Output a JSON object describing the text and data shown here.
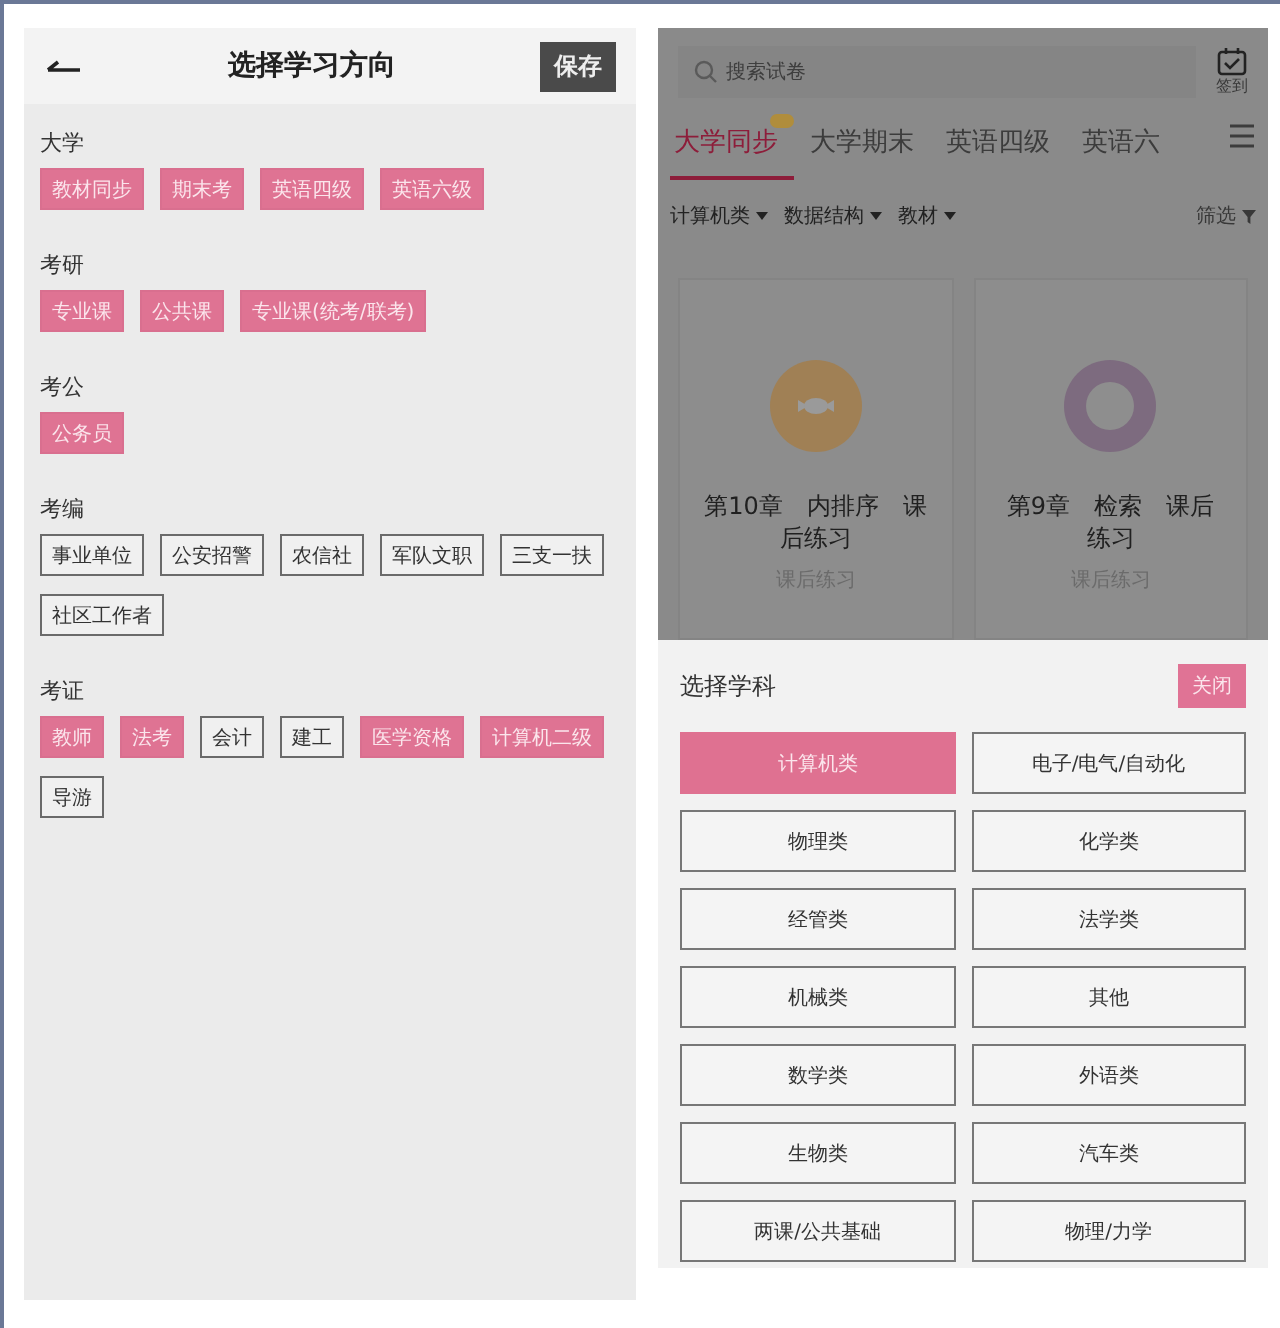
{
  "direction_screen": {
    "title": "选择学习方向",
    "save_button": "保存",
    "sections": [
      {
        "title": "大学",
        "tags": [
          {
            "label": "教材同步",
            "selected": true
          },
          {
            "label": "期末考",
            "selected": true
          },
          {
            "label": "英语四级",
            "selected": true
          },
          {
            "label": "英语六级",
            "selected": true
          }
        ]
      },
      {
        "title": "考研",
        "tags": [
          {
            "label": "专业课",
            "selected": true
          },
          {
            "label": "公共课",
            "selected": true
          },
          {
            "label": "专业课(统考/联考)",
            "selected": true
          }
        ]
      },
      {
        "title": "考公",
        "tags": [
          {
            "label": "公务员",
            "selected": true
          }
        ]
      },
      {
        "title": "考编",
        "tags": [
          {
            "label": "事业单位",
            "selected": false
          },
          {
            "label": "公安招警",
            "selected": false
          },
          {
            "label": "农信社",
            "selected": false
          },
          {
            "label": "军队文职",
            "selected": false
          },
          {
            "label": "三支一扶",
            "selected": false
          },
          {
            "label": "社区工作者",
            "selected": false
          }
        ]
      },
      {
        "title": "考证",
        "tags": [
          {
            "label": "教师",
            "selected": true
          },
          {
            "label": "法考",
            "selected": true
          },
          {
            "label": "会计",
            "selected": false
          },
          {
            "label": "建工",
            "selected": false
          },
          {
            "label": "医学资格",
            "selected": true
          },
          {
            "label": "计算机二级",
            "selected": true
          },
          {
            "label": "导游",
            "selected": false
          }
        ]
      }
    ]
  },
  "exam_screen": {
    "search": {
      "placeholder": "搜索试卷"
    },
    "checkin_label": "签到",
    "tabs": [
      {
        "label": "大学同步",
        "selected": true,
        "badge": true
      },
      {
        "label": "大学期末",
        "selected": false,
        "badge": false
      },
      {
        "label": "英语四级",
        "selected": false,
        "badge": false
      },
      {
        "label": "英语六",
        "selected": false,
        "badge": false
      }
    ],
    "filters": [
      {
        "label": "计算机类"
      },
      {
        "label": "数据结构"
      },
      {
        "label": "教材"
      }
    ],
    "filter_button": "筛选",
    "cards": [
      {
        "title": "第10章　内排序　课后练习",
        "subtitle": "课后练习",
        "kind": "candy"
      },
      {
        "title": "第9章　检索　课后练习",
        "subtitle": "课后练习",
        "kind": "ring"
      }
    ],
    "subject_sheet": {
      "title": "选择学科",
      "close_button": "关闭",
      "subjects": [
        {
          "label": "计算机类",
          "selected": true
        },
        {
          "label": "电子/电气/自动化",
          "selected": false
        },
        {
          "label": "物理类",
          "selected": false
        },
        {
          "label": "化学类",
          "selected": false
        },
        {
          "label": "经管类",
          "selected": false
        },
        {
          "label": "法学类",
          "selected": false
        },
        {
          "label": "机械类",
          "selected": false
        },
        {
          "label": "其他",
          "selected": false
        },
        {
          "label": "数学类",
          "selected": false
        },
        {
          "label": "外语类",
          "selected": false
        },
        {
          "label": "生物类",
          "selected": false
        },
        {
          "label": "汽车类",
          "selected": false
        },
        {
          "label": "两课/公共基础",
          "selected": false
        },
        {
          "label": "物理/力学",
          "selected": false
        }
      ]
    }
  }
}
